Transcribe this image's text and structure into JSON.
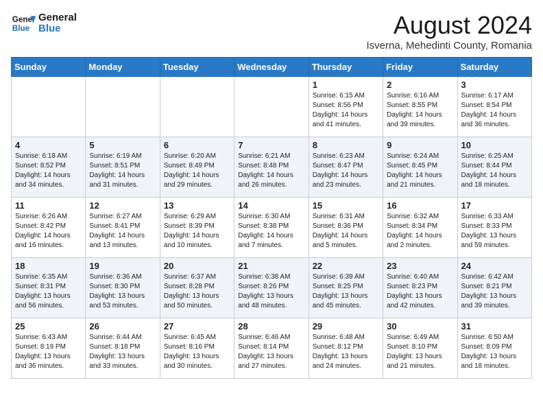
{
  "logo": {
    "line1": "General",
    "line2": "Blue"
  },
  "title": "August 2024",
  "location": "Isverna, Mehedinti County, Romania",
  "days_of_week": [
    "Sunday",
    "Monday",
    "Tuesday",
    "Wednesday",
    "Thursday",
    "Friday",
    "Saturday"
  ],
  "weeks": [
    [
      {
        "day": "",
        "content": ""
      },
      {
        "day": "",
        "content": ""
      },
      {
        "day": "",
        "content": ""
      },
      {
        "day": "",
        "content": ""
      },
      {
        "day": "1",
        "content": "Sunrise: 6:15 AM\nSunset: 8:56 PM\nDaylight: 14 hours\nand 41 minutes."
      },
      {
        "day": "2",
        "content": "Sunrise: 6:16 AM\nSunset: 8:55 PM\nDaylight: 14 hours\nand 39 minutes."
      },
      {
        "day": "3",
        "content": "Sunrise: 6:17 AM\nSunset: 8:54 PM\nDaylight: 14 hours\nand 36 minutes."
      }
    ],
    [
      {
        "day": "4",
        "content": "Sunrise: 6:18 AM\nSunset: 8:52 PM\nDaylight: 14 hours\nand 34 minutes."
      },
      {
        "day": "5",
        "content": "Sunrise: 6:19 AM\nSunset: 8:51 PM\nDaylight: 14 hours\nand 31 minutes."
      },
      {
        "day": "6",
        "content": "Sunrise: 6:20 AM\nSunset: 8:49 PM\nDaylight: 14 hours\nand 29 minutes."
      },
      {
        "day": "7",
        "content": "Sunrise: 6:21 AM\nSunset: 8:48 PM\nDaylight: 14 hours\nand 26 minutes."
      },
      {
        "day": "8",
        "content": "Sunrise: 6:23 AM\nSunset: 8:47 PM\nDaylight: 14 hours\nand 23 minutes."
      },
      {
        "day": "9",
        "content": "Sunrise: 6:24 AM\nSunset: 8:45 PM\nDaylight: 14 hours\nand 21 minutes."
      },
      {
        "day": "10",
        "content": "Sunrise: 6:25 AM\nSunset: 8:44 PM\nDaylight: 14 hours\nand 18 minutes."
      }
    ],
    [
      {
        "day": "11",
        "content": "Sunrise: 6:26 AM\nSunset: 8:42 PM\nDaylight: 14 hours\nand 16 minutes."
      },
      {
        "day": "12",
        "content": "Sunrise: 6:27 AM\nSunset: 8:41 PM\nDaylight: 14 hours\nand 13 minutes."
      },
      {
        "day": "13",
        "content": "Sunrise: 6:29 AM\nSunset: 8:39 PM\nDaylight: 14 hours\nand 10 minutes."
      },
      {
        "day": "14",
        "content": "Sunrise: 6:30 AM\nSunset: 8:38 PM\nDaylight: 14 hours\nand 7 minutes."
      },
      {
        "day": "15",
        "content": "Sunrise: 6:31 AM\nSunset: 8:36 PM\nDaylight: 14 hours\nand 5 minutes."
      },
      {
        "day": "16",
        "content": "Sunrise: 6:32 AM\nSunset: 8:34 PM\nDaylight: 14 hours\nand 2 minutes."
      },
      {
        "day": "17",
        "content": "Sunrise: 6:33 AM\nSunset: 8:33 PM\nDaylight: 13 hours\nand 59 minutes."
      }
    ],
    [
      {
        "day": "18",
        "content": "Sunrise: 6:35 AM\nSunset: 8:31 PM\nDaylight: 13 hours\nand 56 minutes."
      },
      {
        "day": "19",
        "content": "Sunrise: 6:36 AM\nSunset: 8:30 PM\nDaylight: 13 hours\nand 53 minutes."
      },
      {
        "day": "20",
        "content": "Sunrise: 6:37 AM\nSunset: 8:28 PM\nDaylight: 13 hours\nand 50 minutes."
      },
      {
        "day": "21",
        "content": "Sunrise: 6:38 AM\nSunset: 8:26 PM\nDaylight: 13 hours\nand 48 minutes."
      },
      {
        "day": "22",
        "content": "Sunrise: 6:39 AM\nSunset: 8:25 PM\nDaylight: 13 hours\nand 45 minutes."
      },
      {
        "day": "23",
        "content": "Sunrise: 6:40 AM\nSunset: 8:23 PM\nDaylight: 13 hours\nand 42 minutes."
      },
      {
        "day": "24",
        "content": "Sunrise: 6:42 AM\nSunset: 8:21 PM\nDaylight: 13 hours\nand 39 minutes."
      }
    ],
    [
      {
        "day": "25",
        "content": "Sunrise: 6:43 AM\nSunset: 8:19 PM\nDaylight: 13 hours\nand 36 minutes."
      },
      {
        "day": "26",
        "content": "Sunrise: 6:44 AM\nSunset: 8:18 PM\nDaylight: 13 hours\nand 33 minutes."
      },
      {
        "day": "27",
        "content": "Sunrise: 6:45 AM\nSunset: 8:16 PM\nDaylight: 13 hours\nand 30 minutes."
      },
      {
        "day": "28",
        "content": "Sunrise: 6:46 AM\nSunset: 8:14 PM\nDaylight: 13 hours\nand 27 minutes."
      },
      {
        "day": "29",
        "content": "Sunrise: 6:48 AM\nSunset: 8:12 PM\nDaylight: 13 hours\nand 24 minutes."
      },
      {
        "day": "30",
        "content": "Sunrise: 6:49 AM\nSunset: 8:10 PM\nDaylight: 13 hours\nand 21 minutes."
      },
      {
        "day": "31",
        "content": "Sunrise: 6:50 AM\nSunset: 8:09 PM\nDaylight: 13 hours\nand 18 minutes."
      }
    ]
  ]
}
